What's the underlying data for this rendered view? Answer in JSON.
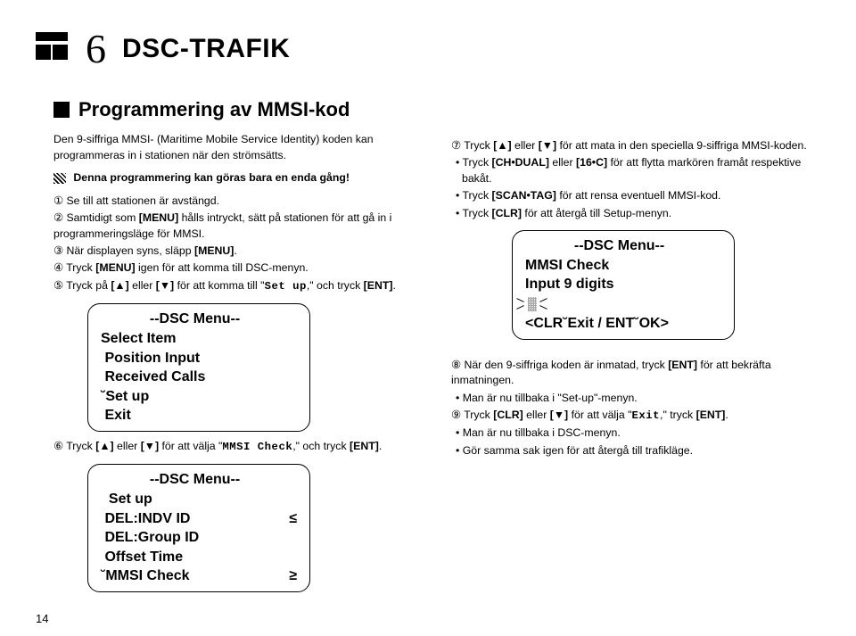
{
  "header": {
    "chapter_num": "6",
    "chapter_title": "DSC-TRAFIK"
  },
  "section": {
    "title": "Programmering av MMSI-kod",
    "intro": "Den 9-siffriga MMSI- (Maritime Mobile Service Identity) koden kan programmeras in i stationen när den strömsätts.",
    "warning": "Denna programmering kan göras bara en enda gång!"
  },
  "stepsA": {
    "s1": "① Se till att stationen är avstängd.",
    "s2_a": "② Samtidigt som ",
    "s2_b": "[MENU]",
    "s2_c": " hålls intryckt, sätt på stationen för att gå in i programmeringsläge för MMSI.",
    "s3_a": "③ När displayen syns, släpp ",
    "s3_b": "[MENU]",
    "s3_c": ".",
    "s4_a": "④ Tryck ",
    "s4_b": "[MENU]",
    "s4_c": " igen för att komma till DSC-menyn.",
    "s5_a": "⑤ Tryck på ",
    "s5_b": "[▲]",
    "s5_c": " eller ",
    "s5_d": "[▼]",
    "s5_e": " för att komma till \"",
    "s5_f": "Set up",
    "s5_g": ",\" och tryck ",
    "s5_h": "[ENT]",
    "s5_i": "."
  },
  "display1": {
    "title": "--DSC Menu--",
    "l1": "Select Item",
    "l2": " Position Input",
    "l3": " Received Calls",
    "l4": "˘Set up",
    "l5": " Exit"
  },
  "stepsB": {
    "s6_a": "⑥ Tryck ",
    "s6_b": "[▲]",
    "s6_c": " eller ",
    "s6_d": "[▼]",
    "s6_e": " för att välja \"",
    "s6_f": "MMSI Check",
    "s6_g": ",\" och tryck ",
    "s6_h": "[ENT]",
    "s6_i": "."
  },
  "display2": {
    "title": "--DSC Menu--",
    "l1": "  Set up",
    "l2": " DEL:INDV ID",
    "l3": " DEL:Group ID",
    "l4": " Offset Time",
    "l5": "˘MMSI Check",
    "up": "≤",
    "down": "≥"
  },
  "stepsR": {
    "s7_a": "⑦ Tryck ",
    "s7_b": "[▲]",
    "s7_c": " eller ",
    "s7_d": "[▼]",
    "s7_e": " för att mata in den speciella 9-siffriga MMSI-koden.",
    "b1_a": "• Tryck ",
    "b1_b": "[CH•DUAL]",
    "b1_c": " eller ",
    "b1_d": "[16•C]",
    "b1_e": " för att flytta markören framåt respektive bakåt.",
    "b2_a": "• Tryck ",
    "b2_b": "[SCAN•TAG]",
    "b2_c": " för att rensa eventuell MMSI-kod.",
    "b3_a": "• Tryck ",
    "b3_b": "[CLR]",
    "b3_c": " för att återgå till Setup-menyn."
  },
  "display3": {
    "title": "--DSC Menu--",
    "l1": "MMSI Check",
    "l2": "Input 9 digits",
    "bottom": "<CLR˘Exit / ENT˘OK>"
  },
  "stepsR2": {
    "s8_a": "⑧ När den 9-siffriga koden är inmatad, tryck ",
    "s8_b": "[ENT]",
    "s8_c": " för att bekräfta inmatningen.",
    "b1": "• Man är nu tillbaka i \"Set-up\"-menyn.",
    "s9_a": "⑨ Tryck ",
    "s9_b": "[CLR]",
    "s9_c": " eller ",
    "s9_d": "[▼]",
    "s9_e": " för att välja \"",
    "s9_f": "Exit",
    "s9_g": ",\" tryck ",
    "s9_h": "[ENT]",
    "s9_i": ".",
    "b2": "• Man är nu tillbaka i DSC-menyn.",
    "b3": "• Gör samma sak igen för att återgå till trafikläge."
  },
  "page_num": "14"
}
